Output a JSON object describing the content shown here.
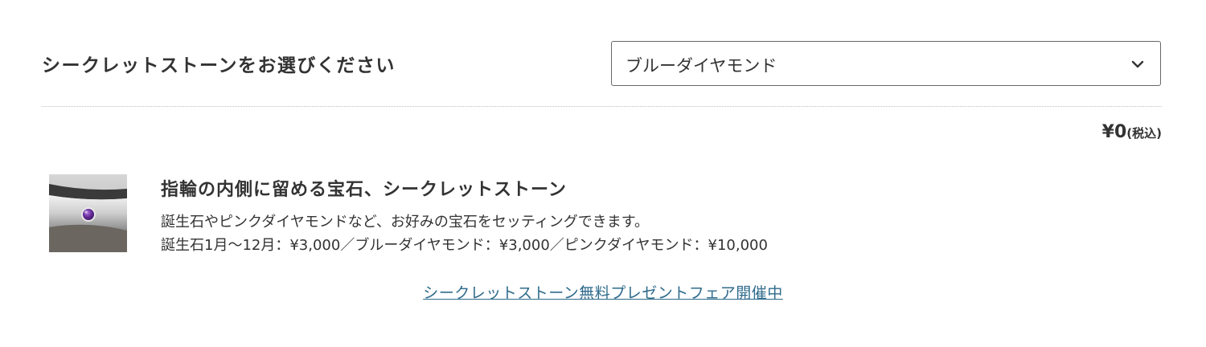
{
  "section": {
    "heading": "シークレットストーンをお選びください"
  },
  "select": {
    "value": "ブルーダイヤモンド",
    "chevron_icon": "chevron-down-icon"
  },
  "price": {
    "amount": "¥0",
    "tax_note": "(税込)"
  },
  "product": {
    "image_icon": "ring-with-purple-stone-photo",
    "title": "指輪の内側に留める宝石、シークレットストーン",
    "description_line1": "誕生石やピンクダイヤモンドなど、お好みの宝石をセッティングできます。",
    "description_line2": "誕生石1月〜12月：¥3,000／ブルーダイヤモンド：¥3,000／ピンクダイヤモンド：¥10,000"
  },
  "campaign": {
    "link_text": "シークレットストーン無料プレゼントフェア開催中"
  },
  "colors": {
    "text": "#333333",
    "link": "#2f6b8c",
    "border": "#666666",
    "stone": "#6a2fa0"
  }
}
